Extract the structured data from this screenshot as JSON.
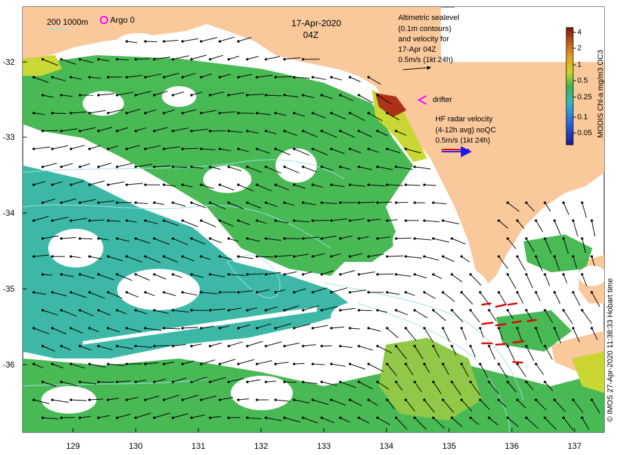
{
  "map": {
    "date": "17-Apr-2020",
    "time": "04Z",
    "lat_ticks": [
      "-32",
      "-33",
      "-34",
      "-35",
      "-36"
    ],
    "lon_ticks": [
      "129",
      "130",
      "131",
      "132",
      "133",
      "134",
      "135",
      "136",
      "137"
    ],
    "lon_range": [
      128.25,
      137.5
    ],
    "lat_range": [
      -36.8,
      -31.25
    ]
  },
  "legend": {
    "depth_label": "200  1000m",
    "argo_label": "Argo 0",
    "altimetry_lines": [
      "Altimetric sealevel",
      "(0.1m contours)",
      "and velocity for",
      "17-Apr 04Z",
      "0.5m/s (1kt 24h)"
    ],
    "drifter_label": "drifter",
    "hf_lines": [
      "HF radar velocity",
      "(4-12h avg) noQC",
      "0.5m/s (1kt 24h)"
    ]
  },
  "colorbar": {
    "title": "MODIS Chl-a mg/m3 OC3",
    "ticks": [
      "4",
      "2",
      "1",
      "0.5",
      "0.25",
      "0.1",
      "0.05"
    ]
  },
  "credit": "© IMOS 27-Apr-2020 11:38:33 Hobart time",
  "colors": {
    "land": "#f9c89b",
    "ocean_cloud": "#ffffff",
    "chl_green": "#3fb64b",
    "chl_teal": "#33b5a3",
    "chl_yellow": "#c8d62c",
    "chl_red": "#a82a10",
    "hf_radar": "#e00000",
    "drifter": "#ff00ff",
    "argo": "#ff00ff",
    "contour": "#9fe0e8"
  }
}
